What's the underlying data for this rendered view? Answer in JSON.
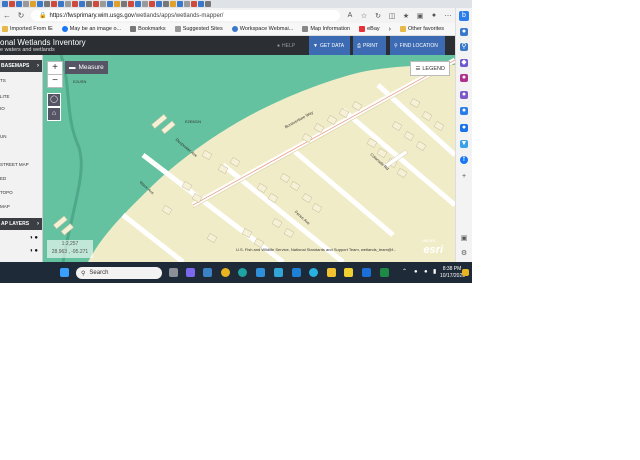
{
  "browser": {
    "url_host": "https://fwsprimary.wim.usgs.gov",
    "url_path": "/wetlands/apps/wetlands-mapper/",
    "favorites": [
      "Imported From IE",
      "May be an image o...",
      "Bookmarks",
      "Suggested Sites",
      "Workspace Webmai...",
      "Map Information",
      "eBay"
    ],
    "other_favorites": "Other favorites"
  },
  "app": {
    "title": "onal Wetlands Inventory",
    "subtitle": "e waters and wetlands",
    "buttons": {
      "help": "HELP",
      "get_data": "GET DATA",
      "print": "PRINT",
      "find_location": "FIND LOCATION"
    }
  },
  "left_panel": {
    "basemaps_header": "BASEMAPS",
    "basemaps": [
      "TS",
      "LITE",
      "IO",
      "UN",
      "STREET MAP",
      "ED",
      "TOPO",
      "MAP"
    ],
    "layers_header": "AP LAYERS",
    "layer_toggles": [
      "◑ ●",
      "◑ ●"
    ]
  },
  "map": {
    "measure_label": "Measure",
    "legend_label": "LEGEND",
    "scale": "1:2,257",
    "coords": "28.963 , -95.271",
    "attribution": "U.S. Fish and Wildlife Service, National Standards and Support Team, wetlands_team@f...",
    "esri_small": "MEURI",
    "esri_logo": "esri",
    "feature_labels": [
      "E2USN",
      "E2EM1N",
      "Bonaventure Way",
      "Colonade Rd",
      "Fence Ave",
      "Deepwater Ave",
      "Wave Ave"
    ]
  },
  "taskbar": {
    "search_placeholder": "Search",
    "time": "8:38 PM",
    "date": "10/17/2023"
  },
  "colors": {
    "wetland": "#64c2a1",
    "upland": "#f1ecc8",
    "road": "#ffffff",
    "header": "#2b2f33",
    "accent": "#3d6bb3"
  }
}
